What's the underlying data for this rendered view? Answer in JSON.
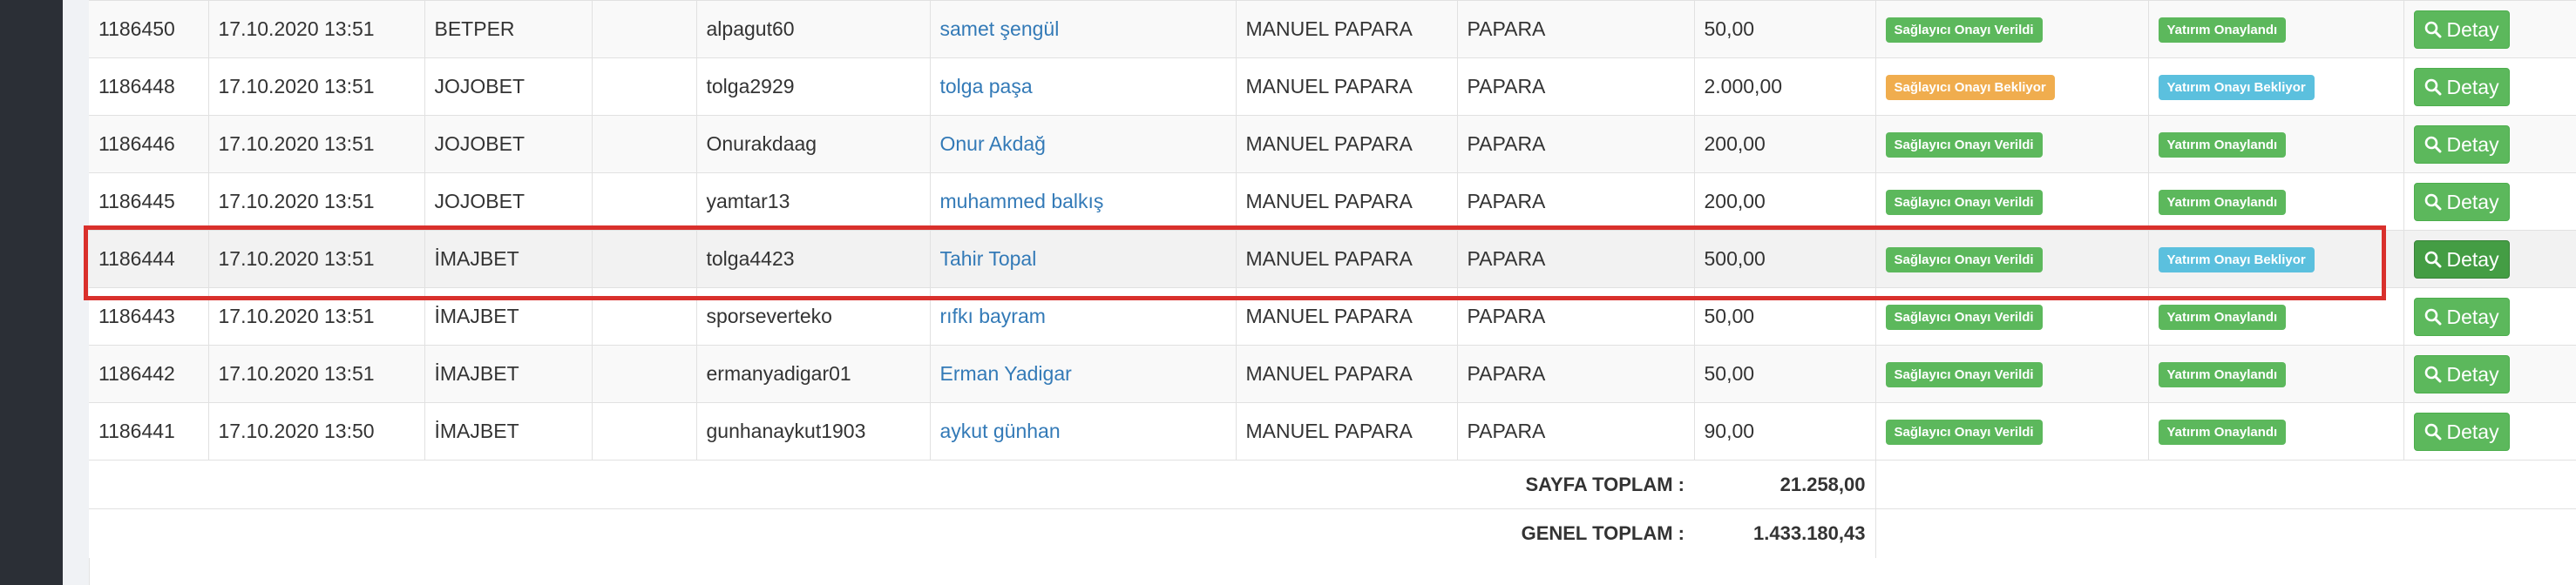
{
  "colors": {
    "success": "#5cb85c",
    "warning": "#f0ad4e",
    "info": "#5bc0de",
    "link": "#337ab7",
    "highlight": "#d9302c",
    "sidebar": "#2b2f36"
  },
  "rows": [
    {
      "id": "1186450",
      "date": "17.10.2020 13:51",
      "site": "BETPER",
      "extra": "",
      "username": "alpagut60",
      "name": "samet şengül",
      "method": "MANUEL PAPARA",
      "bank": "PAPARA",
      "amount": "50,00",
      "provider_status": "Sağlayıcı Onayı Verildi",
      "provider_variant": "success",
      "deposit_status": "Yatırım Onaylandı",
      "deposit_variant": "success",
      "action": "Detay"
    },
    {
      "id": "1186448",
      "date": "17.10.2020 13:51",
      "site": "JOJOBET",
      "extra": "",
      "username": "tolga2929",
      "name": "tolga paşa",
      "method": "MANUEL PAPARA",
      "bank": "PAPARA",
      "amount": "2.000,00",
      "provider_status": "Sağlayıcı Onayı Bekliyor",
      "provider_variant": "warning",
      "deposit_status": "Yatırım Onayı Bekliyor",
      "deposit_variant": "info",
      "action": "Detay"
    },
    {
      "id": "1186446",
      "date": "17.10.2020 13:51",
      "site": "JOJOBET",
      "extra": "",
      "username": "Onurakdaag",
      "name": "Onur Akdağ",
      "method": "MANUEL PAPARA",
      "bank": "PAPARA",
      "amount": "200,00",
      "provider_status": "Sağlayıcı Onayı Verildi",
      "provider_variant": "success",
      "deposit_status": "Yatırım Onaylandı",
      "deposit_variant": "success",
      "action": "Detay"
    },
    {
      "id": "1186445",
      "date": "17.10.2020 13:51",
      "site": "JOJOBET",
      "extra": "",
      "username": "yamtar13",
      "name": "muhammed balkış",
      "method": "MANUEL PAPARA",
      "bank": "PAPARA",
      "amount": "200,00",
      "provider_status": "Sağlayıcı Onayı Verildi",
      "provider_variant": "success",
      "deposit_status": "Yatırım Onaylandı",
      "deposit_variant": "success",
      "action": "Detay"
    },
    {
      "id": "1186444",
      "date": "17.10.2020 13:51",
      "site": "İMAJBET",
      "extra": "",
      "username": "tolga4423",
      "name": "Tahir Topal",
      "method": "MANUEL PAPARA",
      "bank": "PAPARA",
      "amount": "500,00",
      "provider_status": "Sağlayıcı Onayı Verildi",
      "provider_variant": "success",
      "deposit_status": "Yatırım Onayı Bekliyor",
      "deposit_variant": "info",
      "action": "Detay"
    },
    {
      "id": "1186443",
      "date": "17.10.2020 13:51",
      "site": "İMAJBET",
      "extra": "",
      "username": "sporseverteko",
      "name": "rıfkı bayram",
      "method": "MANUEL PAPARA",
      "bank": "PAPARA",
      "amount": "50,00",
      "provider_status": "Sağlayıcı Onayı Verildi",
      "provider_variant": "success",
      "deposit_status": "Yatırım Onaylandı",
      "deposit_variant": "success",
      "action": "Detay"
    },
    {
      "id": "1186442",
      "date": "17.10.2020 13:51",
      "site": "İMAJBET",
      "extra": "",
      "username": "ermanyadigar01",
      "name": "Erman Yadigar",
      "method": "MANUEL PAPARA",
      "bank": "PAPARA",
      "amount": "50,00",
      "provider_status": "Sağlayıcı Onayı Verildi",
      "provider_variant": "success",
      "deposit_status": "Yatırım Onaylandı",
      "deposit_variant": "success",
      "action": "Detay"
    },
    {
      "id": "1186441",
      "date": "17.10.2020 13:50",
      "site": "İMAJBET",
      "extra": "",
      "username": "gunhanaykut1903",
      "name": "aykut günhan",
      "method": "MANUEL PAPARA",
      "bank": "PAPARA",
      "amount": "90,00",
      "provider_status": "Sağlayıcı Onayı Verildi",
      "provider_variant": "success",
      "deposit_status": "Yatırım Onaylandı",
      "deposit_variant": "success",
      "action": "Detay"
    }
  ],
  "totals": {
    "page_label": "SAYFA TOPLAM :",
    "page_value": "21.258,00",
    "grand_label": "GENEL TOPLAM :",
    "grand_value": "1.433.180,43"
  },
  "icons": {
    "detail_button": "search-icon"
  }
}
